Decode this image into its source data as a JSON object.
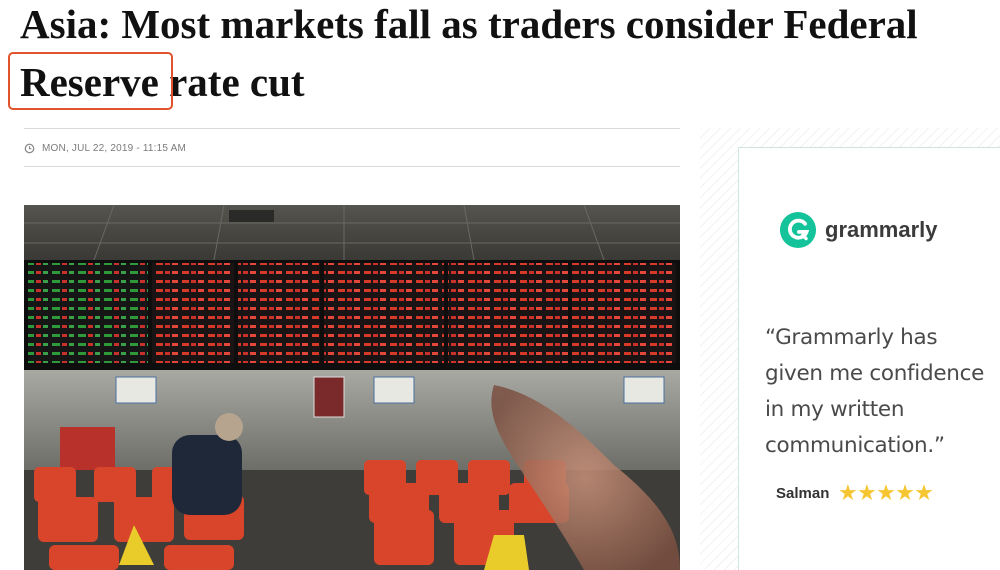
{
  "article": {
    "headline_line1": "Asia: Most markets fall as traders consider Federal",
    "headline_highlight": "Reserve",
    "headline_rest": " rate cut",
    "dateline": "MON, JUL 22, 2019 - 11:15 AM",
    "date_icon": "clock-icon",
    "photo_label": "stock-trading-hall-photo"
  },
  "ad": {
    "brand": "grammarly",
    "brand_color": "#15c39a",
    "quote": "“Grammarly has\ngiven me confidence\nin my written\ncommunication.”",
    "author": "Salman",
    "rating_stars": 5,
    "star_color": "#f6c632"
  },
  "highlight_color": "#e0532c"
}
